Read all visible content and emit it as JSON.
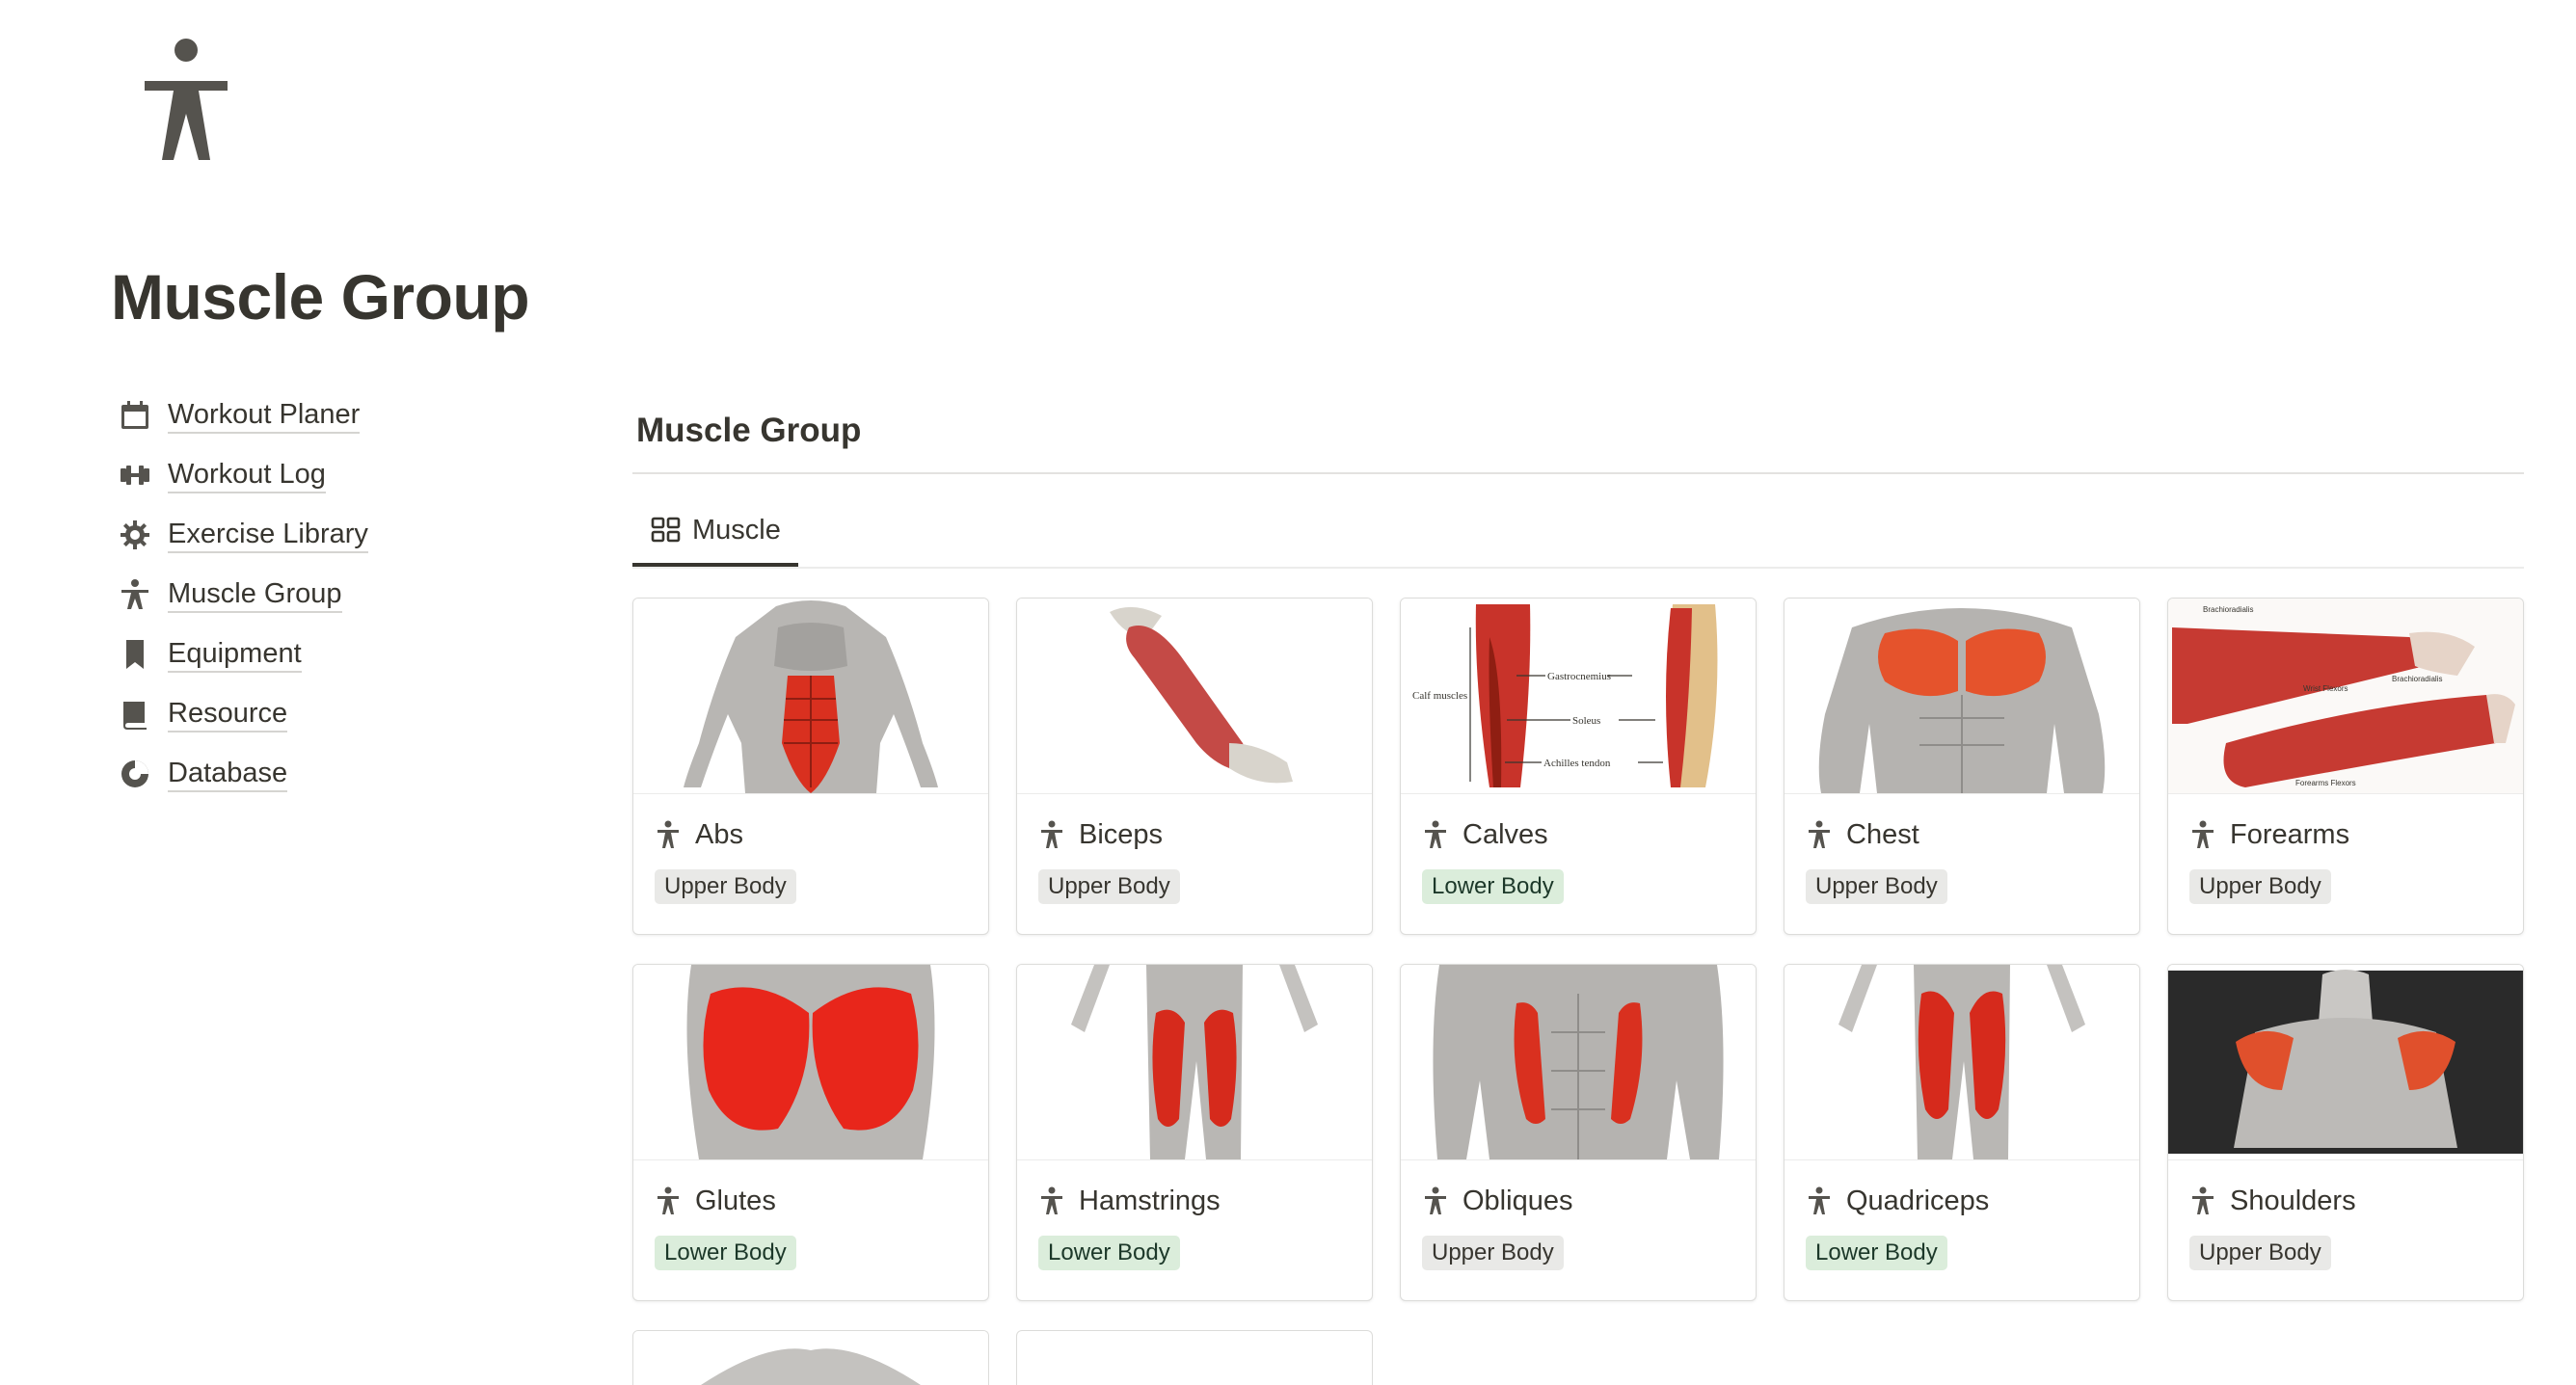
{
  "page": {
    "icon": "person-standing-icon",
    "title": "Muscle Group"
  },
  "nav": {
    "items": [
      {
        "label": "Workout Planer",
        "icon": "calendar-icon"
      },
      {
        "label": "Workout Log",
        "icon": "dumbbell-icon"
      },
      {
        "label": "Exercise Library",
        "icon": "gear-icon"
      },
      {
        "label": "Muscle Group",
        "icon": "person-icon"
      },
      {
        "label": "Equipment",
        "icon": "bookmark-icon"
      },
      {
        "label": "Resource",
        "icon": "book-icon"
      },
      {
        "label": "Database",
        "icon": "pie-chart-icon"
      }
    ]
  },
  "database": {
    "title": "Muscle Group",
    "view_tab": {
      "label": "Muscle",
      "icon": "gallery-grid-icon"
    },
    "cards": [
      {
        "name": "Abs",
        "tag": "Upper Body",
        "image": "abs-anatomy-image"
      },
      {
        "name": "Biceps",
        "tag": "Upper Body",
        "image": "biceps-anatomy-image"
      },
      {
        "name": "Calves",
        "tag": "Lower Body",
        "image": "calves-anatomy-image",
        "image_labels": {
          "left": "Calf muscles",
          "l1": "Gastrocnemius",
          "l2": "Soleus",
          "l3": "Achilles tendon"
        }
      },
      {
        "name": "Chest",
        "tag": "Upper Body",
        "image": "chest-anatomy-image"
      },
      {
        "name": "Forearms",
        "tag": "Upper Body",
        "image": "forearms-anatomy-image",
        "image_labels": {
          "l1": "Brachioradialis",
          "l2": "Wrist Flexors",
          "l3": "Brachioradialis",
          "l4": "Forearms Flexors"
        }
      },
      {
        "name": "Glutes",
        "tag": "Lower Body",
        "image": "glutes-anatomy-image"
      },
      {
        "name": "Hamstrings",
        "tag": "Lower Body",
        "image": "hamstrings-anatomy-image"
      },
      {
        "name": "Obliques",
        "tag": "Upper Body",
        "image": "obliques-anatomy-image"
      },
      {
        "name": "Quadriceps",
        "tag": "Lower Body",
        "image": "quadriceps-anatomy-image"
      },
      {
        "name": "Shoulders",
        "tag": "Upper Body",
        "image": "shoulders-anatomy-image"
      }
    ]
  },
  "colors": {
    "text": "#37352f",
    "upper_tag_bg": "#e9e9e7",
    "lower_tag_bg": "#dbeddb",
    "lower_tag_text": "#1c3829",
    "muscle_red": "#d9301f"
  }
}
